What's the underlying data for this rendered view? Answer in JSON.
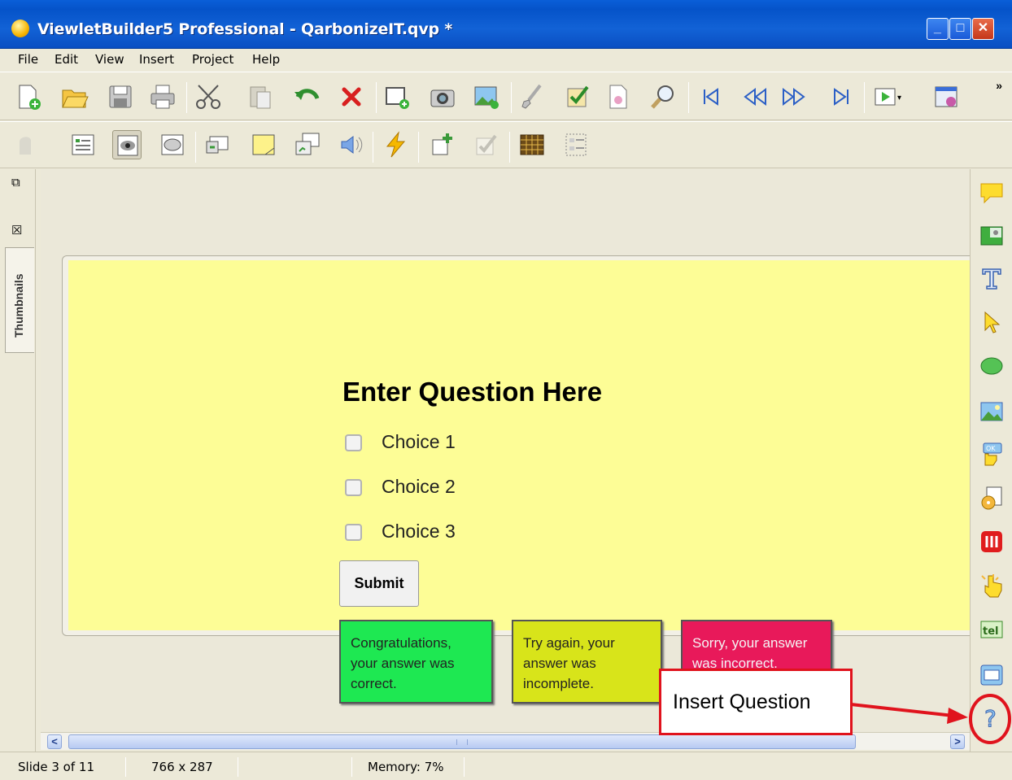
{
  "window": {
    "title": "ViewletBuilder5 Professional - QarbonizeIT.qvp *",
    "minimize_glyph": "_",
    "maximize_glyph": "□",
    "close_glyph": "✕"
  },
  "menu": [
    "File",
    "Edit",
    "View",
    "Insert",
    "Project",
    "Help"
  ],
  "toolbar": {
    "overflow": "»",
    "row1_icons": [
      "new-project-icon",
      "open-icon",
      "save-icon",
      "print-icon",
      "cut-icon",
      "paste-icon",
      "undo-icon",
      "delete-icon",
      "add-slide-icon",
      "capture-icon",
      "import-image-icon",
      "brush-icon",
      "check-icon",
      "document-icon",
      "zoom-icon",
      "first-slide-icon",
      "rewind-icon",
      "forward-icon",
      "last-slide-icon",
      "play-icon",
      "publish-icon"
    ],
    "row2_icons": [
      "pan-icon",
      "properties-icon",
      "eye-icon",
      "oval-icon",
      "callout-icon",
      "note-icon",
      "window-icon",
      "sound-icon",
      "flash-icon",
      "add-object-icon",
      "check-disabled-icon",
      "grid-icon",
      "layout-icon"
    ]
  },
  "left_panel": {
    "tab_label": "Thumbnails",
    "restore_glyph": "⧉",
    "close_glyph": "☒"
  },
  "slide": {
    "question": "Enter Question Here",
    "choices": [
      "Choice 1",
      "Choice 2",
      "Choice 3"
    ],
    "submit_label": "Submit",
    "feedback": {
      "correct": "Congratulations, your answer was correct.",
      "incomplete": "Try again, your answer was incomplete.",
      "incorrect": "Sorry, your answer was incorrect."
    },
    "colors": {
      "background": "#fdfd96",
      "correct": "#1ee852",
      "incomplete": "#d8e41a",
      "incorrect": "#e8195a"
    }
  },
  "scrollbar": {
    "left_arrow": "<",
    "right_arrow": ">"
  },
  "right_panel_icons": [
    "speech-bubble-icon",
    "image-box-icon",
    "text-icon",
    "pointer-icon",
    "shape-icon",
    "picture-icon",
    "button-icon",
    "media-icon",
    "flash-object-icon",
    "click-zone-icon",
    "text-entry-icon",
    "window-object-icon",
    "question-icon"
  ],
  "status": {
    "slide": "Slide 3 of 11",
    "size": "766 x 287",
    "memory": "Memory: 7%"
  },
  "annotation": {
    "label": "Insert Question",
    "color": "#e0131d"
  }
}
